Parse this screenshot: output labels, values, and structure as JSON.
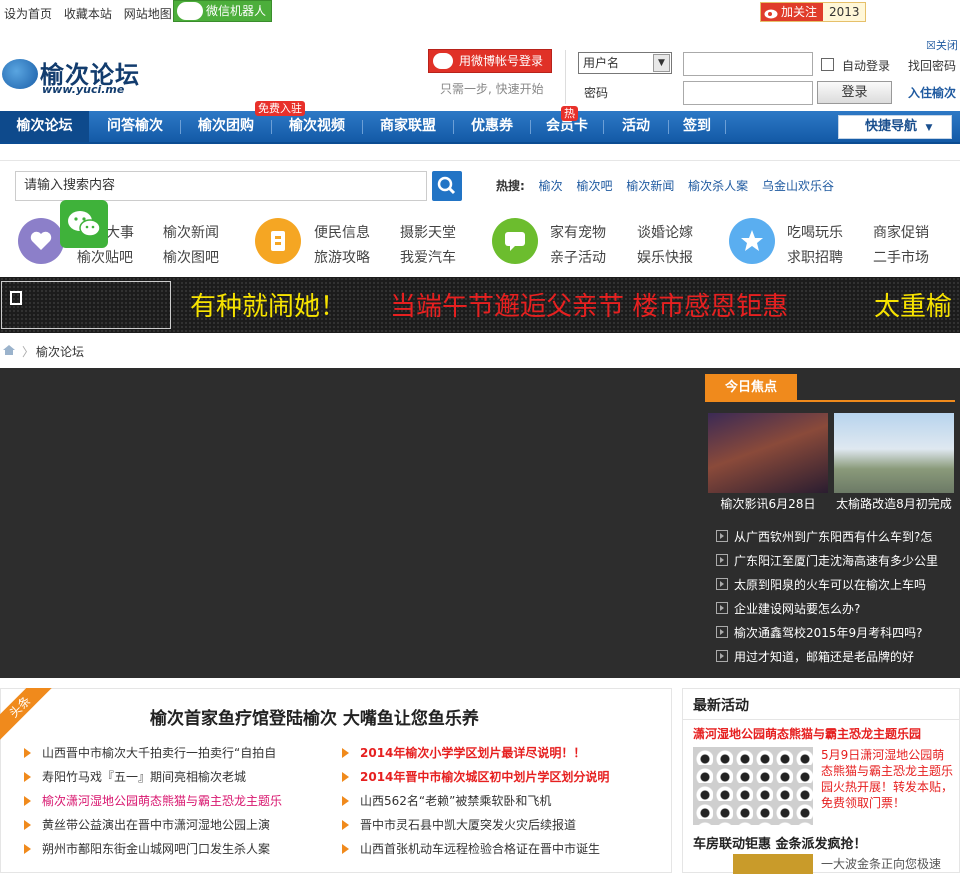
{
  "topbar": {
    "links": [
      "设为首页",
      "收藏本站",
      "网站地图"
    ],
    "wechat_bot": "微信机器人",
    "follow_label": "加关注",
    "follow_count": "2013"
  },
  "header": {
    "logo_text": "榆次论坛",
    "logo_url": "www.yuci.me",
    "weibo_login": "用微博帐号登录",
    "weibo_sub": "只需一步, 快速开始",
    "username_option": "用户名",
    "password_label": "密码",
    "auto_login": "自动登录",
    "login_button": "登录",
    "close_label": "关闭",
    "find_password": "找回密码",
    "join": "入住榆次"
  },
  "nav": {
    "items": [
      "榆次论坛",
      "问答榆次",
      "榆次团购",
      "榆次视频",
      "商家联盟",
      "优惠券",
      "会员卡",
      "活动",
      "签到"
    ],
    "badge_free": "免费入驻",
    "badge_hot": "热",
    "quick_nav": "快捷导航"
  },
  "search": {
    "placeholder": "请输入搜索内容",
    "hot_label": "热搜:",
    "hot_terms": [
      "榆次",
      "榆次吧",
      "榆次新闻",
      "榆次杀人案",
      "乌金山欢乐谷"
    ]
  },
  "categories": {
    "labels": [
      "大事",
      "榆次新闻",
      "榆次贴吧",
      "榆次图吧",
      "便民信息",
      "摄影天堂",
      "旅游攻略",
      "我爱汽车",
      "家有宠物",
      "谈婚论嫁",
      "亲子活动",
      "娱乐快报",
      "吃喝玩乐",
      "商家促销",
      "求职招聘",
      "二手市场"
    ]
  },
  "ticker": {
    "text1": "有种就闹她！",
    "text2": "当端午节邂逅父亲节  楼市感恩钜惠",
    "text3": "太重榆"
  },
  "breadcrumb": {
    "current": "榆次论坛"
  },
  "focus": {
    "tab": "今日焦点",
    "captions": [
      "榆次影讯6月28日",
      "太榆路改造8月初完成"
    ],
    "list": [
      "从广西钦州到广东阳西有什么车到?怎",
      "广东阳江至厦门走沈海高速有多少公里",
      "太原到阳泉的火车可以在榆次上车吗",
      "企业建设网站要怎么办?",
      "榆次通鑫驾校2015年9月考科四吗?",
      "用过才知道，邮箱还是老品牌的好"
    ]
  },
  "news": {
    "ribbon": "头条",
    "headline": "榆次首家鱼疗馆登陆榆次  大嘴鱼让您鱼乐养",
    "left": [
      {
        "text": "山西晋中市榆次大千拍卖行一拍卖行“自拍自",
        "style": ""
      },
      {
        "text": "寿阳竹马戏『五一』期间亮相榆次老城",
        "style": ""
      },
      {
        "text": "榆次潇河湿地公园萌态熊猫与霸主恐龙主题乐",
        "style": "pink"
      },
      {
        "text": "黄丝带公益演出在晋中市潇河湿地公园上演",
        "style": ""
      },
      {
        "text": "朔州市鄯阳东街金山城网吧门口发生杀人案",
        "style": ""
      }
    ],
    "right": [
      {
        "text": "2014年榆次小学学区划片最详尽说明！！",
        "style": "red"
      },
      {
        "text": "2014年晋中市榆次城区初中划片学区划分说明",
        "style": "red"
      },
      {
        "text": "山西562名“老赖”被禁乘软卧和飞机",
        "style": ""
      },
      {
        "text": "晋中市灵石县中凯大厦突发火灾后续报道",
        "style": ""
      },
      {
        "text": "山西首张机动车远程检验合格证在晋中市诞生",
        "style": ""
      }
    ]
  },
  "activity": {
    "title": "最新活动",
    "item1_title": "潇河湿地公园萌态熊猫与霸主恐龙主题乐园",
    "item1_desc": "5月9日潇河湿地公园萌态熊猫与霸主恐龙主题乐园火热开展！转发本贴，免费领取门票！",
    "item2_title": "车房联动钜惠 金条派发疯抢！",
    "item2_desc": "一大波金条正向您极速"
  }
}
